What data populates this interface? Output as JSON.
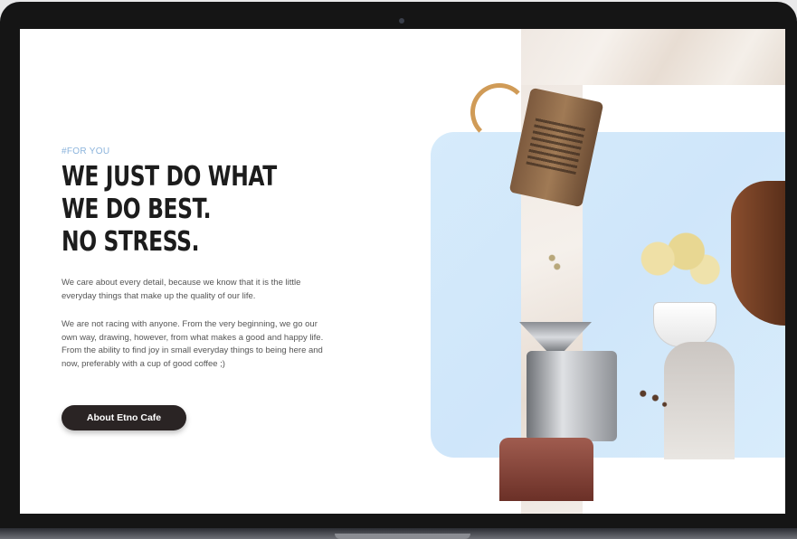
{
  "hero": {
    "tag": "#FOR YOU",
    "headline_lines": [
      "WE JUST DO WHAT",
      "WE DO BEST.",
      "NO STRESS."
    ],
    "paragraph1": "We care about every detail, because we know that it is the little everyday things that make up the quality of our life.",
    "paragraph2": "We are not racing with anyone. From the very beginning, we go our own way, drawing, however, from what makes a good and happy life. From the ability to find joy in small everyday things to being here and now, preferably with a cup of good coffee ;)",
    "cta_label": "About Etno Cafe"
  },
  "colors": {
    "tag": "#8cb4dc",
    "headline": "#1c1c1c",
    "cta_background": "#2a2424",
    "card_blue": "#d6ebfb"
  }
}
